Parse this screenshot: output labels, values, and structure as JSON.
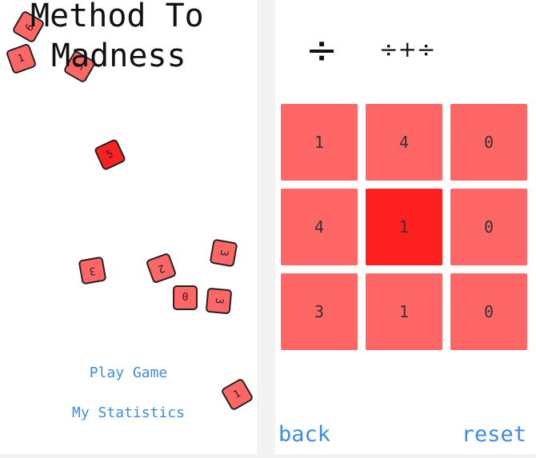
{
  "menu": {
    "title_line1": "Method To",
    "title_line2": "Madness",
    "play_label": "Play Game",
    "stats_label": "My Statistics",
    "tiles": [
      "9",
      "1",
      "3",
      "5",
      "3",
      "3",
      "2",
      "0",
      "3",
      "1"
    ]
  },
  "game": {
    "operator_symbol": "÷",
    "operator_sequence": "÷+÷",
    "grid": [
      [
        "1",
        "4",
        "0"
      ],
      [
        "4",
        "1",
        "0"
      ],
      [
        "3",
        "1",
        "0"
      ]
    ],
    "back_label": "back",
    "reset_label": "reset"
  },
  "colors": {
    "tile": "#ff6666",
    "tile_active": "#ff2020",
    "link": "#3a8de6"
  }
}
